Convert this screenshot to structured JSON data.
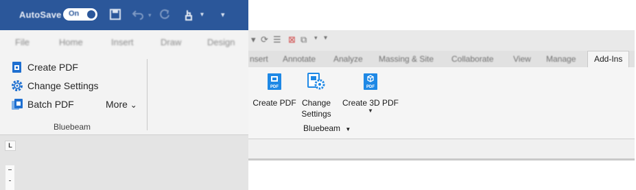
{
  "word": {
    "autosave_label": "AutoSave",
    "autosave_state": "On",
    "tabs": [
      "File",
      "Home",
      "Insert",
      "Draw",
      "Design"
    ],
    "bluebeam_group": {
      "items": [
        {
          "label": "Create PDF",
          "icon": "create-pdf-icon"
        },
        {
          "label": "Change Settings",
          "icon": "gear-icon"
        },
        {
          "label": "Batch PDF",
          "icon": "batch-pdf-icon"
        }
      ],
      "more_label": "More",
      "more_caret": "⌄",
      "group_label": "Bluebeam"
    },
    "ruler_corner": "L",
    "accent_color": "#2b579a"
  },
  "revit": {
    "tabs": [
      "nsert",
      "Annotate",
      "Analyze",
      "Massing & Site",
      "Collaborate",
      "View",
      "Manage",
      "Add-Ins"
    ],
    "active_tab": "Add-Ins",
    "buttons": [
      {
        "label": "Create PDF",
        "icon": "create-pdf-icon"
      },
      {
        "label_line1": "Change",
        "label_line2": "Settings",
        "icon": "pdf-settings-icon"
      },
      {
        "label": "Create 3D PDF",
        "icon": "create-3d-pdf-icon",
        "has_dropdown": true
      }
    ],
    "panel_label": "Bluebeam",
    "panel_caret": "▼",
    "accent_color": "#1e88e5"
  }
}
